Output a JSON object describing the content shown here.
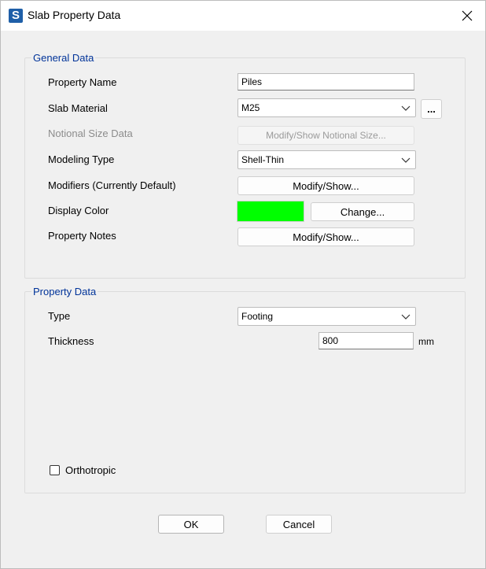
{
  "window": {
    "title": "Slab Property Data",
    "app_icon_letter": "S"
  },
  "general": {
    "title": "General Data",
    "property_name_label": "Property Name",
    "property_name_value": "Piles",
    "slab_material_label": "Slab Material",
    "slab_material_value": "M25",
    "ellipsis_label": "...",
    "notional_label": "Notional Size Data",
    "notional_button": "Modify/Show Notional Size...",
    "modeling_type_label": "Modeling Type",
    "modeling_type_value": "Shell-Thin",
    "modifiers_label": "Modifiers (Currently Default)",
    "modifiers_button": "Modify/Show...",
    "display_color_label": "Display Color",
    "display_color": "#00ff00",
    "change_button": "Change...",
    "notes_label": "Property Notes",
    "notes_button": "Modify/Show..."
  },
  "property": {
    "title": "Property Data",
    "type_label": "Type",
    "type_value": "Footing",
    "thickness_label": "Thickness",
    "thickness_value": "800",
    "thickness_unit": "mm",
    "orthotropic_label": "Orthotropic",
    "orthotropic_checked": false
  },
  "footer": {
    "ok_label": "OK",
    "cancel_label": "Cancel"
  }
}
